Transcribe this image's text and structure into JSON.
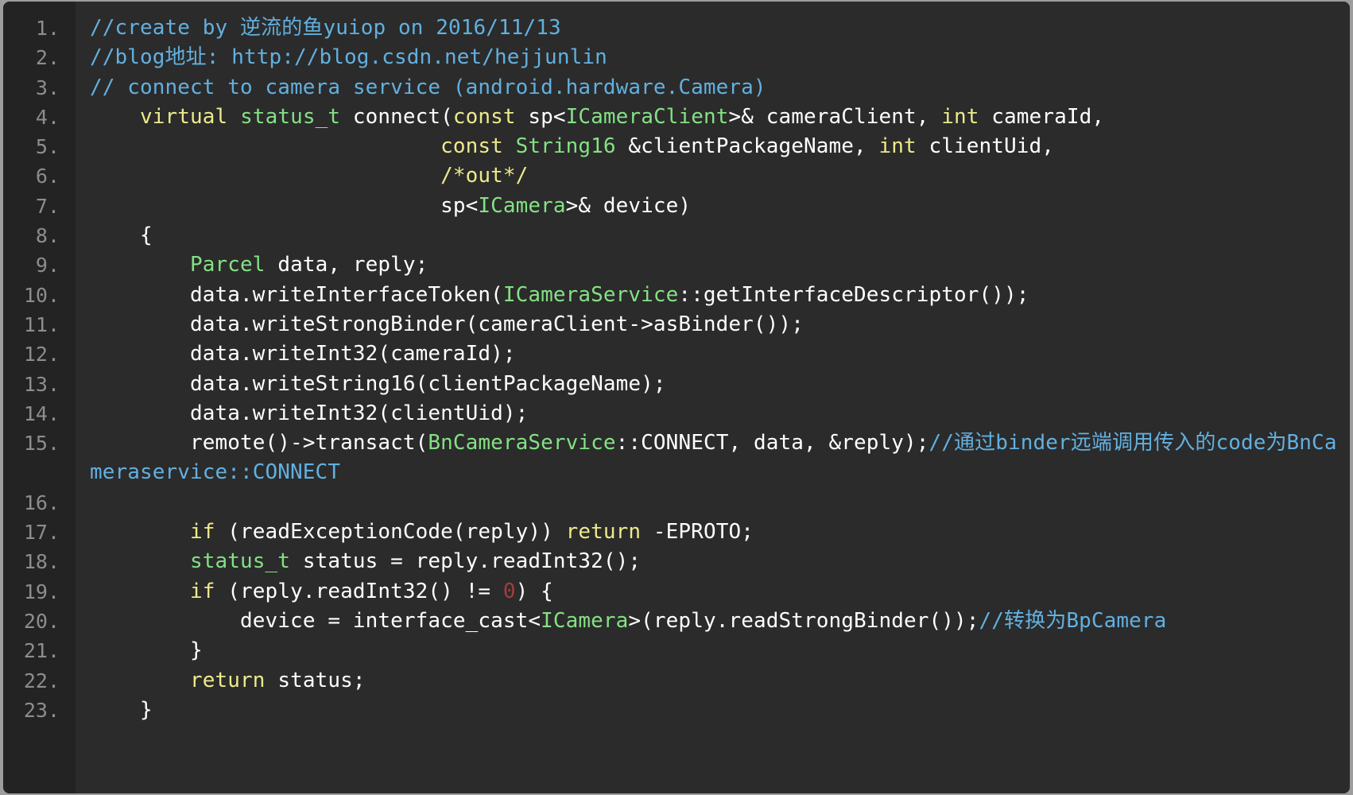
{
  "editor": {
    "language": "cpp",
    "theme": "dark",
    "background_color": "#2b2b2b",
    "gutter_color": "#232323",
    "page_color": "#9d9d9d",
    "colors": {
      "comment": "#62b0e0",
      "keyword": "#ecea8c",
      "type": "#84e184",
      "number": "#a43c3c",
      "text": "#ffffff",
      "line_number": "#8d8d8d"
    },
    "line_number_suffix": ".",
    "line_numbers": [
      "1",
      "2",
      "3",
      "4",
      "5",
      "6",
      "7",
      "8",
      "9",
      "10",
      "11",
      "12",
      "13",
      "14",
      "15",
      "16",
      "17",
      "18",
      "19",
      "20",
      "21",
      "22",
      "23"
    ],
    "lines": [
      {
        "n": "1",
        "tokens": [
          {
            "t": "//create by 逆流的鱼yuiop on 2016/11/13",
            "c": "com"
          }
        ]
      },
      {
        "n": "2",
        "tokens": [
          {
            "t": "//blog地址: http://blog.csdn.net/hejjunlin",
            "c": "com"
          }
        ]
      },
      {
        "n": "3",
        "tokens": [
          {
            "t": "// connect to camera service (android.hardware.Camera)",
            "c": "com"
          }
        ]
      },
      {
        "n": "4",
        "tokens": [
          {
            "t": "    ",
            "c": "txt"
          },
          {
            "t": "virtual",
            "c": "kw"
          },
          {
            "t": " ",
            "c": "txt"
          },
          {
            "t": "status_t",
            "c": "type"
          },
          {
            "t": " connect(",
            "c": "txt"
          },
          {
            "t": "const",
            "c": "kw"
          },
          {
            "t": " sp<",
            "c": "txt"
          },
          {
            "t": "ICameraClient",
            "c": "type"
          },
          {
            "t": ">& cameraClient, ",
            "c": "txt"
          },
          {
            "t": "int",
            "c": "kw"
          },
          {
            "t": " cameraId,",
            "c": "txt"
          }
        ]
      },
      {
        "n": "5",
        "tokens": [
          {
            "t": "                            ",
            "c": "txt"
          },
          {
            "t": "const",
            "c": "kw"
          },
          {
            "t": " ",
            "c": "txt"
          },
          {
            "t": "String16",
            "c": "type"
          },
          {
            "t": " &clientPackageName, ",
            "c": "txt"
          },
          {
            "t": "int",
            "c": "kw"
          },
          {
            "t": " clientUid,",
            "c": "txt"
          }
        ]
      },
      {
        "n": "6",
        "tokens": [
          {
            "t": "                            ",
            "c": "txt"
          },
          {
            "t": "/*out*/",
            "c": "kw"
          }
        ]
      },
      {
        "n": "7",
        "tokens": [
          {
            "t": "                            sp<",
            "c": "txt"
          },
          {
            "t": "ICamera",
            "c": "type"
          },
          {
            "t": ">& device)",
            "c": "txt"
          }
        ]
      },
      {
        "n": "8",
        "tokens": [
          {
            "t": "    {",
            "c": "txt"
          }
        ]
      },
      {
        "n": "9",
        "tokens": [
          {
            "t": "        ",
            "c": "txt"
          },
          {
            "t": "Parcel",
            "c": "type"
          },
          {
            "t": " data, reply;",
            "c": "txt"
          }
        ]
      },
      {
        "n": "10",
        "tokens": [
          {
            "t": "        data.writeInterfaceToken(",
            "c": "txt"
          },
          {
            "t": "ICameraService",
            "c": "type"
          },
          {
            "t": "::getInterfaceDescriptor());",
            "c": "txt"
          }
        ]
      },
      {
        "n": "11",
        "tokens": [
          {
            "t": "        data.writeStrongBinder(cameraClient->asBinder());",
            "c": "txt"
          }
        ]
      },
      {
        "n": "12",
        "tokens": [
          {
            "t": "        data.writeInt32(cameraId);",
            "c": "txt"
          }
        ]
      },
      {
        "n": "13",
        "tokens": [
          {
            "t": "        data.writeString16(clientPackageName);",
            "c": "txt"
          }
        ]
      },
      {
        "n": "14",
        "tokens": [
          {
            "t": "        data.writeInt32(clientUid);",
            "c": "txt"
          }
        ]
      },
      {
        "n": "15",
        "wrapped": true,
        "tokens": [
          {
            "t": "        remote()->transact(",
            "c": "txt"
          },
          {
            "t": "BnCameraService",
            "c": "type"
          },
          {
            "t": "::CONNECT, data, &reply);",
            "c": "txt"
          },
          {
            "t": "//通过binder远端调用传入的code为BnCameraservice::CONNECT",
            "c": "com"
          }
        ]
      },
      {
        "n": "16",
        "tokens": [
          {
            "t": "",
            "c": "txt"
          }
        ]
      },
      {
        "n": "17",
        "tokens": [
          {
            "t": "        ",
            "c": "txt"
          },
          {
            "t": "if",
            "c": "kw"
          },
          {
            "t": " (readExceptionCode(reply)) ",
            "c": "txt"
          },
          {
            "t": "return",
            "c": "kw"
          },
          {
            "t": " -EPROTO;",
            "c": "txt"
          }
        ]
      },
      {
        "n": "18",
        "tokens": [
          {
            "t": "        ",
            "c": "txt"
          },
          {
            "t": "status_t",
            "c": "type"
          },
          {
            "t": " status = reply.readInt32();",
            "c": "txt"
          }
        ]
      },
      {
        "n": "19",
        "tokens": [
          {
            "t": "        ",
            "c": "txt"
          },
          {
            "t": "if",
            "c": "kw"
          },
          {
            "t": " (reply.readInt32() != ",
            "c": "txt"
          },
          {
            "t": "0",
            "c": "num"
          },
          {
            "t": ") {",
            "c": "txt"
          }
        ]
      },
      {
        "n": "20",
        "tokens": [
          {
            "t": "            device = interface_cast<",
            "c": "txt"
          },
          {
            "t": "ICamera",
            "c": "type"
          },
          {
            "t": ">(reply.readStrongBinder());",
            "c": "txt"
          },
          {
            "t": "//转换为BpCamera",
            "c": "com"
          }
        ]
      },
      {
        "n": "21",
        "tokens": [
          {
            "t": "        }",
            "c": "txt"
          }
        ]
      },
      {
        "n": "22",
        "tokens": [
          {
            "t": "        ",
            "c": "txt"
          },
          {
            "t": "return",
            "c": "kw"
          },
          {
            "t": " status;",
            "c": "txt"
          }
        ]
      },
      {
        "n": "23",
        "tokens": [
          {
            "t": "    }",
            "c": "txt"
          }
        ]
      }
    ]
  }
}
